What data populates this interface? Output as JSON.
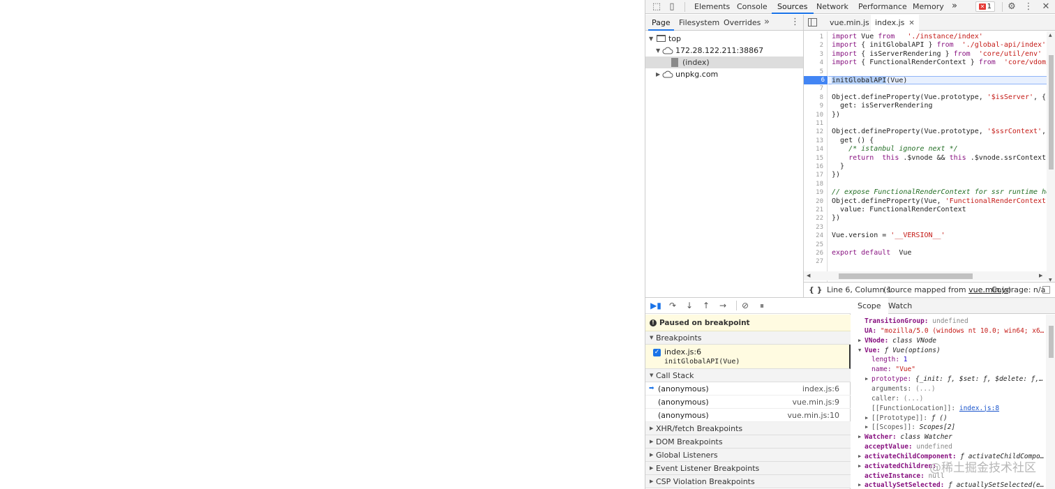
{
  "topbar": {
    "tabs": [
      "Elements",
      "Console",
      "Sources",
      "Network",
      "Performance",
      "Memory"
    ],
    "more": "»",
    "error_count": "1"
  },
  "navigator": {
    "tabs": [
      "Page",
      "Filesystem",
      "Overrides"
    ],
    "more": "»",
    "tree": [
      "top",
      "172.28.122.211:38867",
      "(index)",
      "unpkg.com"
    ]
  },
  "editor": {
    "tabs": [
      "vue.min.js",
      "index.js"
    ],
    "current_line": 6,
    "status": {
      "position": "Line 6, Column 1",
      "mapped_prefix": "(source mapped from ",
      "mapped_link": "vue.min.js",
      "mapped_suffix": ")",
      "coverage": "Coverage: n/a"
    }
  },
  "debugger": {
    "paused": "Paused on breakpoint",
    "sections": {
      "breakpoints": "Breakpoints",
      "call_stack": "Call Stack",
      "xhr": "XHR/fetch Breakpoints",
      "dom": "DOM Breakpoints",
      "global": "Global Listeners",
      "event": "Event Listener Breakpoints",
      "csp": "CSP Violation Breakpoints"
    },
    "breakpoint": {
      "file": "index.js:6",
      "code": "initGlobalAPI(Vue)"
    },
    "call_stack": [
      {
        "fn": "(anonymous)",
        "loc": "index.js:6"
      },
      {
        "fn": "(anonymous)",
        "loc": "vue.min.js:9"
      },
      {
        "fn": "(anonymous)",
        "loc": "vue.min.js:10"
      }
    ]
  },
  "scope": {
    "tabs": [
      "Scope",
      "Watch"
    ],
    "rows": [
      {
        "key": "TransitionGroup",
        "value": "undefined"
      },
      {
        "key": "UA",
        "value": "\"mozilla/5.0 (windows nt 10.0; win64; x6…"
      },
      {
        "key": "VNode",
        "value": "class VNode"
      },
      {
        "key": "Vue",
        "value": "ƒ Vue(options)"
      },
      {
        "key": "length",
        "value": "1"
      },
      {
        "key": "name",
        "value": "\"Vue\""
      },
      {
        "key": "prototype",
        "value": "{_init: ƒ, $set: ƒ, $delete: ƒ,…"
      },
      {
        "key": "arguments",
        "value": "(...)"
      },
      {
        "key": "caller",
        "value": "(...)"
      },
      {
        "key": "[[FunctionLocation]]",
        "value": "index.js:8"
      },
      {
        "key": "[[Prototype]]",
        "value": "ƒ ()"
      },
      {
        "key": "[[Scopes]]",
        "value": "Scopes[2]"
      },
      {
        "key": "Watcher",
        "value": "class Watcher"
      },
      {
        "key": "acceptValue",
        "value": "undefined"
      },
      {
        "key": "activateChildComponent",
        "value": "ƒ activateChildCompo…"
      },
      {
        "key": "activatedChildren",
        "value": ""
      },
      {
        "key": "activeInstance",
        "value": "null"
      },
      {
        "key": "actuallySetSelected",
        "value": "ƒ actuallySetSelected(e…"
      }
    ]
  },
  "watermark": "@稀土掘金技术社区"
}
